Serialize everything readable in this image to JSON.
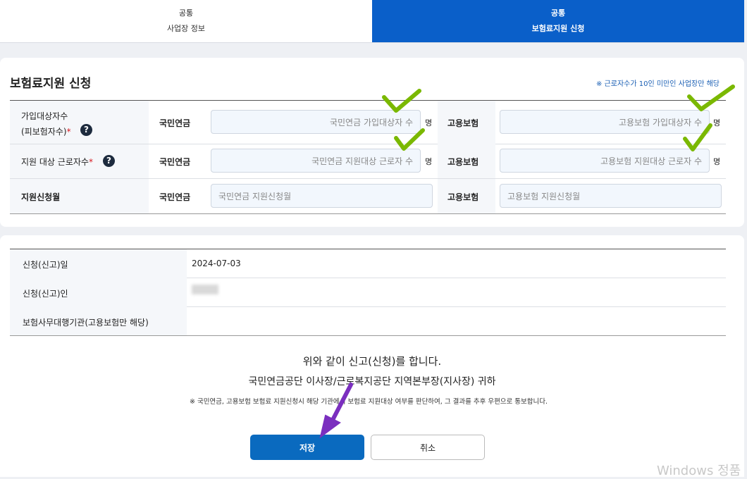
{
  "tabs": [
    {
      "top": "공통",
      "sub": "사업장 정보"
    },
    {
      "top": "공통",
      "sub": "보험료지원 신청"
    }
  ],
  "section": {
    "title": "보험료지원 신청",
    "note": "※ 근로자수가 10인 미만인 사업장만 해당"
  },
  "form": {
    "row1": {
      "label1": "가입대상자수",
      "label2": "(피보험자수)",
      "required": "*",
      "help": "?",
      "pension_label": "국민연금",
      "pension_placeholder": "국민연금 가입대상자 수",
      "pension_unit": "명",
      "employment_label": "고용보험",
      "employment_placeholder": "고용보험 가입대상자 수",
      "employment_unit": "명"
    },
    "row2": {
      "label": "지원 대상 근로자수",
      "required": "*",
      "help": "?",
      "pension_label": "국민연금",
      "pension_placeholder": "국민연금 지원대상 근로자 수",
      "pension_unit": "명",
      "employment_label": "고용보험",
      "employment_placeholder": "고용보험 지원대상 근로자 수",
      "employment_unit": "명"
    },
    "row3": {
      "label": "지원신청월",
      "pension_label": "국민연금",
      "pension_placeholder": "국민연금 지원신청월",
      "employment_label": "고용보험",
      "employment_placeholder": "고용보험 지원신청월"
    }
  },
  "info": {
    "date_label": "신청(신고)일",
    "date_value": "2024-07-03",
    "applicant_label": "신청(신고)인",
    "agency_label": "보험사무대행기관(고용보험만 해당)"
  },
  "declaration": {
    "line1": "위와 같이 신고(신청)를 합니다.",
    "line2": "국민연금공단 이사장/근로복지공단 지역본부장(지사장) 귀하",
    "note": "※ 국민연금, 고용보험 보험료 지원신청시 해당 기관에서 보험료 지원대상 여부를 판단하여, 그 결과를 추후 우편으로 통보합니다."
  },
  "buttons": {
    "save": "저장",
    "cancel": "취소"
  },
  "watermark": "Windows 정품",
  "colors": {
    "accent": "#0a5fc9",
    "save_button": "#0a6abf",
    "check_mark": "#7ab800",
    "arrow": "#7b2fbf"
  }
}
